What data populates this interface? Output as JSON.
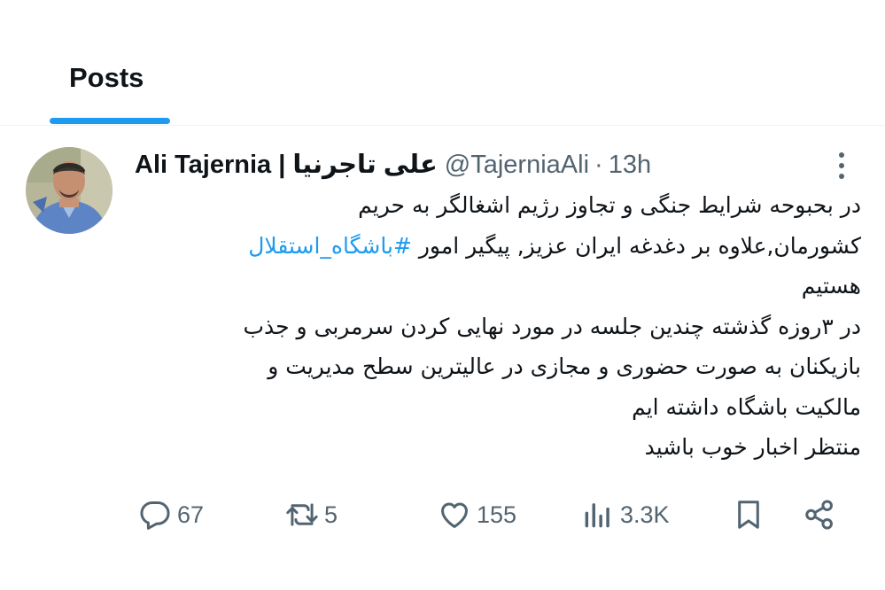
{
  "tabs": {
    "posts_label": "Posts"
  },
  "tweet": {
    "author": {
      "display_name": "Ali Tajernia | علی تاجرنیا",
      "handle": "@TajerniaAli",
      "separator": "·",
      "time": "13h"
    },
    "text": {
      "line1": "در بحبوحه شرایط جنگی و تجاوز رژیم اشغالگر به حریم",
      "line2_start": "کشورمان,علاوه بر دغدغه ایران عزیز, پیگیر امور ",
      "hashtag": "#باشگاه_استقلال",
      "line3": "هستیم",
      "line4": "در ۳روزه گذشته چندین جلسه در مورد نهایی کردن سرمربی و جذب",
      "line5": "بازیکنان به صورت حضوری و مجازی در عالیترین سطح مدیریت و",
      "line6": "مالکیت باشگاه داشته ایم",
      "line7": "منتظر اخبار خوب باشید"
    },
    "actions": {
      "replies": "67",
      "reposts": "5",
      "likes": "155",
      "views": "3.3K"
    }
  },
  "colors": {
    "accent": "#1d9bf0",
    "text_primary": "#0f1419",
    "text_secondary": "#536471",
    "divider": "#eff3f4"
  },
  "icons": {
    "reply": "speech-bubble-icon",
    "repost": "retweet-icon",
    "like": "heart-icon",
    "views": "bar-chart-icon",
    "bookmark": "bookmark-icon",
    "share": "share-icon",
    "more": "vertical-dots-icon"
  }
}
